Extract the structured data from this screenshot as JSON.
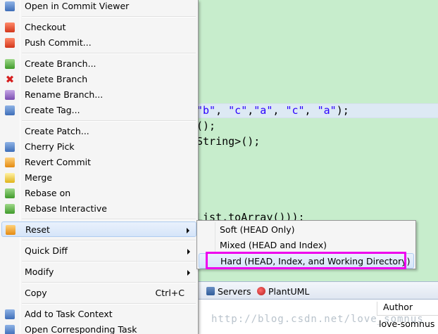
{
  "editor": {
    "line1": "\"b\", \"c\",\"a\", \"c\", \"a\");",
    "line1_parts": [
      {
        "t": "\"b\"",
        "s": true
      },
      {
        "t": ", ",
        "s": false
      },
      {
        "t": "\"c\"",
        "s": true
      },
      {
        "t": ",",
        "s": false
      },
      {
        "t": "\"a\"",
        "s": true
      },
      {
        "t": ", ",
        "s": false
      },
      {
        "t": "\"c\"",
        "s": true
      },
      {
        "t": ", ",
        "s": false
      },
      {
        "t": "\"a\"",
        "s": true
      },
      {
        "t": ");",
        "s": false
      }
    ],
    "line2": "();",
    "line3": "String>();",
    "line4": "List.toArray()));"
  },
  "menu": {
    "items": [
      {
        "label": "Open in Commit Viewer",
        "icon": "commit-viewer-icon"
      },
      {
        "label": "Checkout",
        "icon": "checkout-icon"
      },
      {
        "label": "Push Commit...",
        "icon": "push-icon"
      },
      {
        "label": "Create Branch...",
        "icon": "create-branch-icon"
      },
      {
        "label": "Delete Branch",
        "icon": "delete-icon"
      },
      {
        "label": "Rename Branch...",
        "icon": "rename-icon"
      },
      {
        "label": "Create Tag...",
        "icon": "tag-icon"
      },
      {
        "label": "Create Patch...",
        "icon": ""
      },
      {
        "label": "Cherry Pick",
        "icon": "cherry-pick-icon"
      },
      {
        "label": "Revert Commit",
        "icon": "revert-icon"
      },
      {
        "label": "Merge",
        "icon": "merge-icon"
      },
      {
        "label": "Rebase on",
        "icon": "rebase-icon"
      },
      {
        "label": "Rebase Interactive",
        "icon": "rebase-interactive-icon"
      },
      {
        "label": "Reset",
        "icon": "reset-icon"
      },
      {
        "label": "Quick Diff",
        "icon": ""
      },
      {
        "label": "Modify",
        "icon": ""
      },
      {
        "label": "Copy",
        "icon": "",
        "accel": "Ctrl+C"
      },
      {
        "label": "Add to Task Context",
        "icon": "task-context-icon"
      },
      {
        "label": "Open Corresponding Task",
        "icon": "task-icon"
      }
    ]
  },
  "reset_submenu": {
    "items": [
      {
        "label": "Soft (HEAD Only)"
      },
      {
        "label": "Mixed (HEAD and Index)"
      },
      {
        "label": "Hard (HEAD, Index, and Working Directory)"
      }
    ]
  },
  "bottom_panel": {
    "tabs": [
      {
        "label": "Servers",
        "icon": "servers-icon"
      },
      {
        "label": "PlantUML",
        "icon": "plantuml-icon"
      }
    ],
    "column_header": "Author",
    "author_value": "love-somnus",
    "watermark": "http://blog.csdn.net/love_somnus"
  },
  "colors": {
    "editor_bg": "#c7edcc",
    "highlight_border": "#ee00ee",
    "string_literal": "#2a00ff"
  }
}
